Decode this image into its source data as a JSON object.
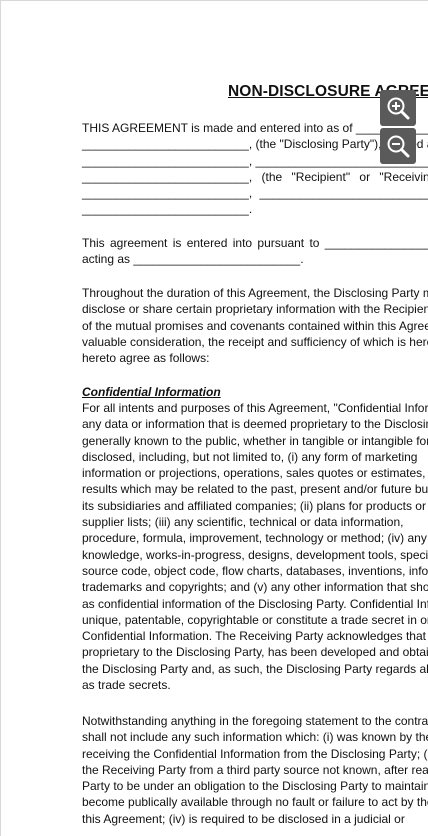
{
  "document": {
    "title": "NON-DISCLOSURE AGREEMENT",
    "intro_lines": [
      "THIS AGREEMENT is made and entered into as of ________________",
      "_________________________, (the \"Disclosing Party\"), located at",
      "_________________________, __________________________________",
      "_________________________,     (the     \"Recipient\"     or     \"Receiving",
      "_________________________,    ____________________________,",
      "_________________________."
    ],
    "pursuant_lines": [
      "This  agreement  is  entered  into  pursuant  to  _________________",
      "acting as _________________________."
    ],
    "para1_lines": [
      "Throughout the duration of this Agreement, the Disclosing Party may",
      "disclose or share certain proprietary information with the Recipient. In",
      "of the mutual promises and covenants contained within this Agreement",
      "valuable consideration, the receipt and sufficiency of which is hereby",
      "hereto agree as follows:"
    ],
    "section_heading": "Confidential Information",
    "para2_lines": [
      "For all intents and purposes of this Agreement, \"Confidential Information\"",
      "any data or information that is deemed proprietary to the Disclosing Party",
      "generally known to the public, whether in tangible or intangible form,",
      "disclosed, including, but not limited to, (i) any form of marketing",
      "information or projections, operations, sales quotes or estimates, pricing",
      "results which may be related to the past, present and/or future business",
      "its subsidiaries and affiliated companies; (ii) plans for products or",
      "supplier lists; (iii) any scientific, technical or data information,",
      "procedure, formula, improvement, technology or method; (iv) any",
      "knowledge, works-in-progress, designs, development tools, specifications,",
      "source code, object code, flow charts, databases, inventions, information",
      "trademarks and copyrights; and (v) any other information that should",
      "as confidential information of the Disclosing Party. Confidential Information",
      "unique, patentable, copyrightable or constitute a trade secret in order",
      "Confidential Information. The Receiving Party acknowledges that the",
      "proprietary to the Disclosing Party, has been developed and obtained through",
      "the Disclosing Party and, as such, the Disclosing Party regards all of",
      "as trade secrets."
    ],
    "para3_lines": [
      "Notwithstanding anything in the foregoing statement to the contrary,",
      "shall not include any such information which: (i) was known by the",
      "receiving the Confidential Information from the Disclosing Party; (ii)",
      "the Receiving Party from a third party source not known, after reasonable",
      "Party to be under an obligation to the Disclosing Party to maintain",
      "become publically available through no fault or failure to act by the",
      "this Agreement; (iv) is required to be disclosed in a judicial or"
    ]
  },
  "toolbar": {
    "zoom_in_icon": "zoom-in-icon",
    "zoom_out_icon": "zoom-out-icon",
    "button_color": "#5a5a5a"
  }
}
